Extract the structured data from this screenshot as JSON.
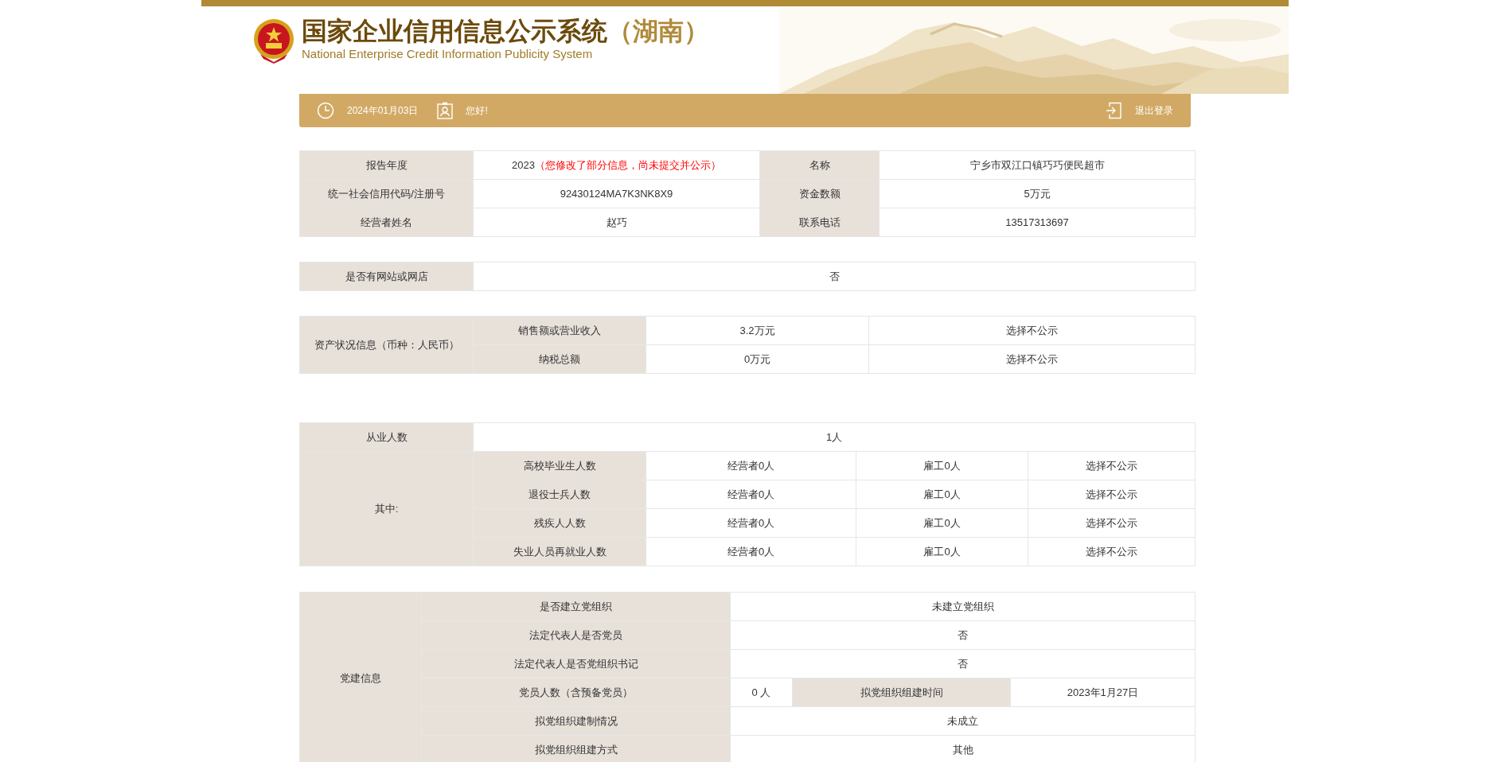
{
  "header": {
    "title": "国家企业信用信息公示系统",
    "region": "（湖南）",
    "subtitle": "National Enterprise Credit Information Publicity System"
  },
  "toolbar": {
    "date": "2024年01月03日",
    "greeting": "您好!",
    "logout": "退出登录"
  },
  "basic_info": [
    [
      {
        "label": "报告年度",
        "value": "2023",
        "note": "（您修改了部分信息，尚未提交并公示）"
      },
      {
        "label": "名称",
        "value": "宁乡市双江口镇巧巧便民超市"
      }
    ],
    [
      {
        "label": "统一社会信用代码/注册号",
        "value": "92430124MA7K3NK8X9"
      },
      {
        "label": "资金数额",
        "value": "5万元"
      }
    ],
    [
      {
        "label": "经营者姓名",
        "value": "赵巧"
      },
      {
        "label": "联系电话",
        "value": "13517313697"
      }
    ]
  ],
  "website": {
    "label": "是否有网站或网店",
    "value": "否"
  },
  "assets": {
    "label": "资产状况信息（币种：人民币）",
    "rows": [
      {
        "label": "销售额或营业收入",
        "value": "3.2万元",
        "publicity": "选择不公示"
      },
      {
        "label": "纳税总额",
        "value": "0万元",
        "publicity": "选择不公示"
      }
    ]
  },
  "employees": {
    "label": "从业人数",
    "value": "1人",
    "group_label": "其中:",
    "rows": [
      {
        "label": "高校毕业生人数",
        "operator": "经营者0人",
        "hired": "雇工0人",
        "publicity": "选择不公示"
      },
      {
        "label": "退役士兵人数",
        "operator": "经营者0人",
        "hired": "雇工0人",
        "publicity": "选择不公示"
      },
      {
        "label": "残疾人人数",
        "operator": "经营者0人",
        "hired": "雇工0人",
        "publicity": "选择不公示"
      },
      {
        "label": "失业人员再就业人数",
        "operator": "经营者0人",
        "hired": "雇工0人",
        "publicity": "选择不公示"
      }
    ]
  },
  "party": {
    "label": "党建信息",
    "rows": [
      {
        "kind": "single",
        "label": "是否建立党组织",
        "value": "未建立党组织"
      },
      {
        "kind": "single",
        "label": "法定代表人是否党员",
        "value": "否"
      },
      {
        "kind": "single",
        "label": "法定代表人是否党组织书记",
        "value": "否"
      },
      {
        "kind": "pair",
        "label": "党员人数（含预备党员）",
        "value": "0 人",
        "extra_label": "拟党组织组建时间",
        "extra_value": "2023年1月27日"
      },
      {
        "kind": "single",
        "label": "拟党组织建制情况",
        "value": "未成立"
      },
      {
        "kind": "single",
        "label": "拟党组织组建方式",
        "value": "其他"
      }
    ]
  }
}
